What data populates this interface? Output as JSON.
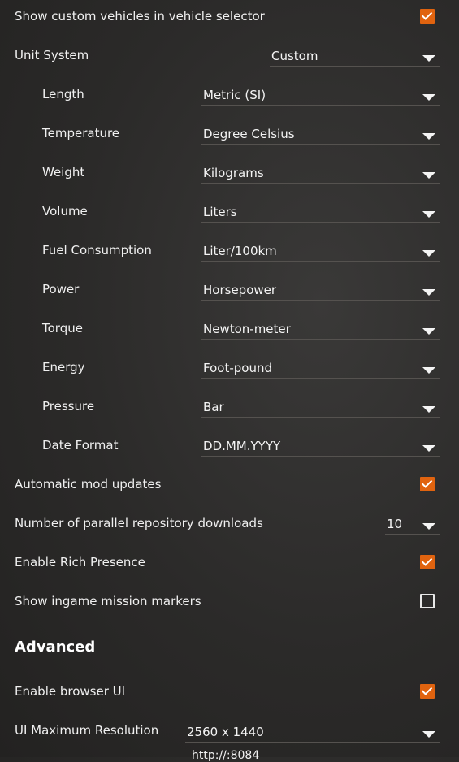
{
  "settings": {
    "custom_vehicles": {
      "label": "Show custom vehicles in vehicle selector",
      "checked": true
    },
    "unit_system": {
      "label": "Unit System",
      "value": "Custom"
    },
    "units": [
      {
        "label": "Length",
        "value": "Metric (SI)"
      },
      {
        "label": "Temperature",
        "value": "Degree Celsius"
      },
      {
        "label": "Weight",
        "value": "Kilograms"
      },
      {
        "label": "Volume",
        "value": "Liters"
      },
      {
        "label": "Fuel Consumption",
        "value": "Liter/100km"
      },
      {
        "label": "Power",
        "value": "Horsepower"
      },
      {
        "label": "Torque",
        "value": "Newton-meter"
      },
      {
        "label": "Energy",
        "value": "Foot-pound"
      },
      {
        "label": "Pressure",
        "value": "Bar"
      },
      {
        "label": "Date Format",
        "value": "DD.MM.YYYY"
      }
    ],
    "auto_mod_updates": {
      "label": "Automatic mod updates",
      "checked": true
    },
    "parallel_downloads": {
      "label": "Number of parallel repository downloads",
      "value": "10"
    },
    "rich_presence": {
      "label": "Enable Rich Presence",
      "checked": true
    },
    "mission_markers": {
      "label": "Show ingame mission markers",
      "checked": false
    }
  },
  "advanced": {
    "title": "Advanced",
    "browser_ui": {
      "label": "Enable browser UI",
      "checked": true
    },
    "max_resolution": {
      "label": "UI Maximum Resolution",
      "value": "2560 x 1440"
    },
    "cutoff_text": "http://:8084"
  },
  "colors": {
    "accent": "#e0630f",
    "background": "#2b2a29"
  }
}
